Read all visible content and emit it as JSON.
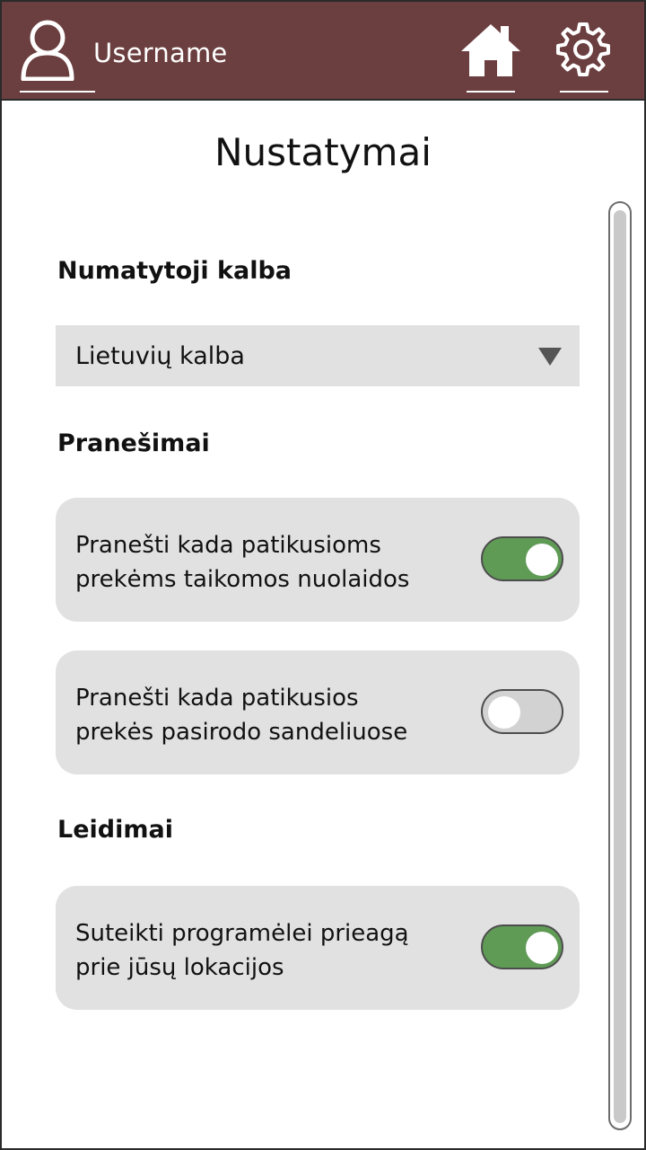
{
  "colors": {
    "header_bg": "#6b3e3f",
    "header_text": "#ffffff",
    "panel_bg": "#e1e1e1",
    "toggle_on": "#5f9b55",
    "toggle_off": "#d2d2d2"
  },
  "header": {
    "username": "Username",
    "user_icon": "user-icon",
    "home_icon": "home-icon",
    "settings_icon": "gear-icon"
  },
  "page": {
    "title": "Nustatymai"
  },
  "language": {
    "heading": "Numatytoji kalba",
    "selected": "Lietuvių kalba"
  },
  "notifications": {
    "heading": "Pranešimai",
    "items": [
      {
        "line1": "Pranešti kada patikusioms",
        "line2": "prekėms taikomos nuolaidos",
        "enabled": true
      },
      {
        "line1": "Pranešti kada patikusios",
        "line2": "prekės pasirodo sandeliuose",
        "enabled": false
      }
    ]
  },
  "permissions": {
    "heading": "Leidimai",
    "items": [
      {
        "line1": "Suteikti programėlei prieagą",
        "line2": "prie jūsų lokacijos",
        "enabled": true
      }
    ]
  }
}
